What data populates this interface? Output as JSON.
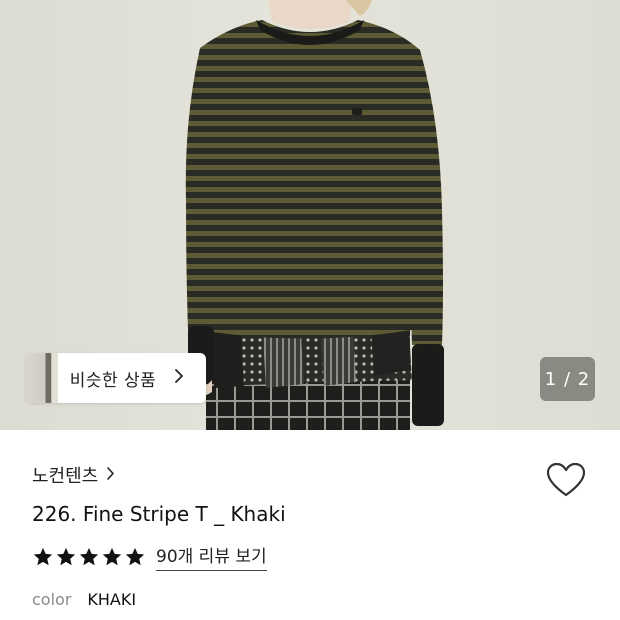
{
  "gallery": {
    "similar_button_label": "비슷한 상품",
    "current": 1,
    "total": 2,
    "counter_sep": " / "
  },
  "product": {
    "brand": "노컨텐츠",
    "title": "226. Fine Stripe T _ Khaki",
    "rating_stars": 5,
    "review_link": "90개 리뷰 보기",
    "option_key": "color",
    "option_value": "KHAKI"
  },
  "icons": {
    "brand_chevron": "chevron-right-icon",
    "similar_chevron": "chevron-right-icon",
    "wishlist": "heart-outline-icon",
    "star": "star-filled-icon"
  },
  "colors": {
    "star": "#111111",
    "heart_stroke": "#333333",
    "shirt_khaki": "#5a5a34",
    "shirt_dark": "#2a2a26"
  }
}
